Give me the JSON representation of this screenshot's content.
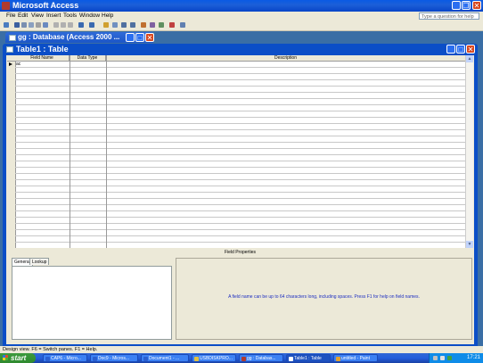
{
  "app": {
    "title": "Microsoft Access"
  },
  "menu": {
    "items": [
      "File",
      "Edit",
      "View",
      "Insert",
      "Tools",
      "Window",
      "Help"
    ],
    "help_placeholder": "Type a question for help"
  },
  "db_window": {
    "title": "gg : Database (Access 2000 ..."
  },
  "table_window": {
    "title": "Table1 : Table"
  },
  "grid": {
    "columns": [
      "Field Name",
      "Data Type",
      "Description"
    ],
    "first_row_field": "ac"
  },
  "field_properties": {
    "label": "Field Properties",
    "tabs": [
      "General",
      "Lookup"
    ],
    "help_text": "A field name can be up to 64 characters long, including spaces.  Press F1 for help on field names."
  },
  "status": {
    "text": "Design view.  F6 = Switch panes.  F1 = Help."
  },
  "taskbar": {
    "start_label": "start",
    "tasks": [
      "CAP6 - Micro...",
      "Doc9 - Micros...",
      "Document1 - ...",
      "USBDISKPRO...",
      "gg : Databas...",
      "Table1 : Table",
      "untitled - Paint"
    ],
    "clock": "17:21"
  },
  "colors": {
    "titlebar": "#0a5ae4",
    "taskbar": "#245edb",
    "start": "#3c9a3c"
  }
}
